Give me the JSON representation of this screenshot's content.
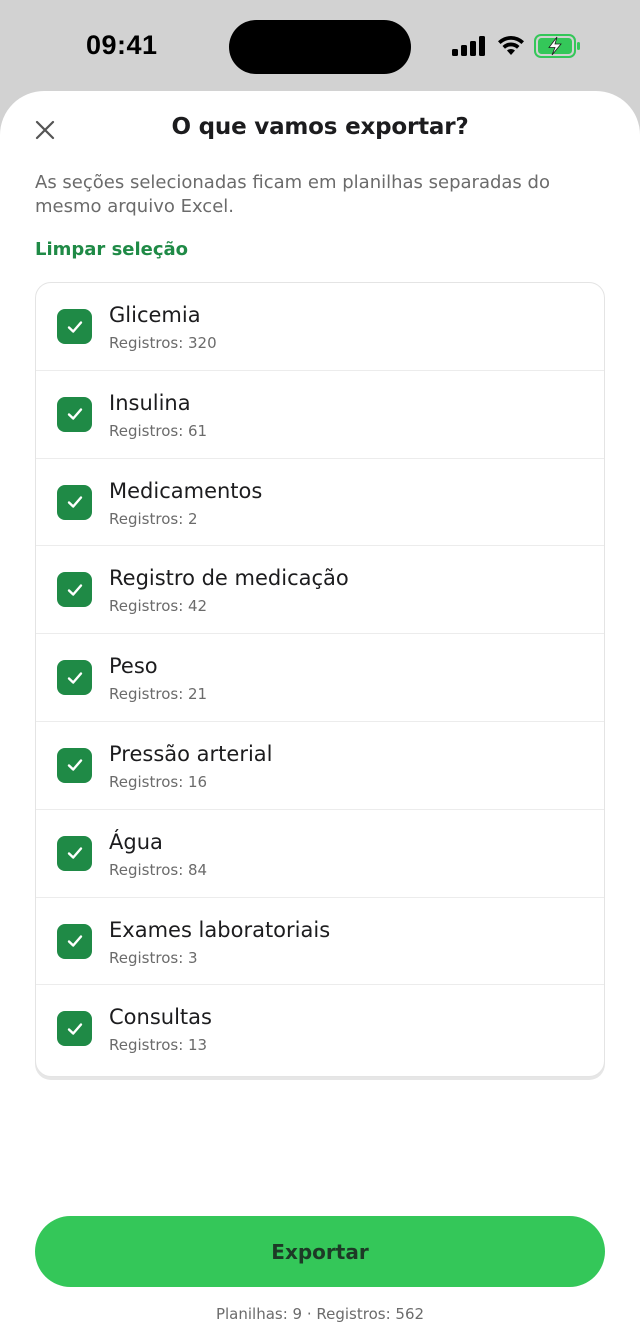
{
  "status_bar": {
    "time": "09:41"
  },
  "header": {
    "title": "O que vamos exportar?",
    "close_icon": "close-icon"
  },
  "subtitle": "As seções selecionadas ficam em planilhas separadas do mesmo arquivo Excel.",
  "clear_selection": "Limpar seleção",
  "sections": [
    {
      "label": "Glicemia",
      "count": "Registros: 320",
      "checked": true
    },
    {
      "label": "Insulina",
      "count": "Registros: 61",
      "checked": true
    },
    {
      "label": "Medicamentos",
      "count": "Registros: 2",
      "checked": true
    },
    {
      "label": "Registro de medicação",
      "count": "Registros: 42",
      "checked": true
    },
    {
      "label": "Peso",
      "count": "Registros: 21",
      "checked": true
    },
    {
      "label": "Pressão arterial",
      "count": "Registros: 16",
      "checked": true
    },
    {
      "label": "Água",
      "count": "Registros: 84",
      "checked": true
    },
    {
      "label": "Exames laboratoriais",
      "count": "Registros: 3",
      "checked": true
    },
    {
      "label": "Consultas",
      "count": "Registros: 13",
      "checked": true
    }
  ],
  "export_button": "Exportar",
  "summary": "Planilhas: 9 · Registros: 562",
  "colors": {
    "accent_green": "#1f8a46",
    "button_green": "#34c759",
    "button_text": "#1d3a26"
  }
}
